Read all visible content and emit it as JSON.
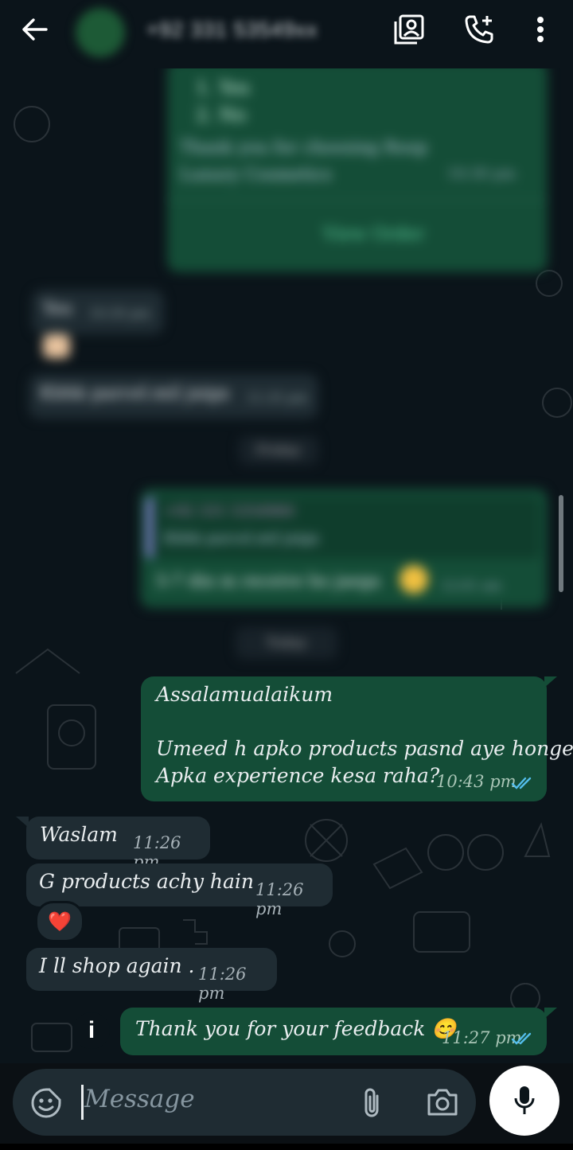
{
  "header": {
    "contact_name": "+92 331 53549xx",
    "back_icon": "arrow-left-icon",
    "contact_card_icon": "contact-card-icon",
    "call_icon": "add-call-icon",
    "menu_icon": "more-vert-icon"
  },
  "blurred_history": {
    "options": [
      "1. Yes",
      "2. No"
    ],
    "thanks": "Thank you for choosing Roop Luxury Cosmetics",
    "thanks_time": "10:30 pm",
    "view_order": "View Order",
    "reply1": "Yes",
    "reply1_time": "10:30 pm",
    "reply2": "Kbhk parcel.mil jaiga",
    "reply2_time": "11:35 pm",
    "day1": "Friday",
    "quote_sender": "+92 331 5354960",
    "quote_text": "Kbhk parcel.mil jaiga",
    "quote_reply": "5-7 din m receive ho jaega",
    "quote_time": "12:01 am",
    "day2": "Today"
  },
  "messages": [
    {
      "dir": "out",
      "lines": [
        "Assalamualaikum",
        "",
        "Umeed h apko products pasnd aye honge.",
        "Apka experience kesa raha?"
      ],
      "time": "10:43 pm"
    },
    {
      "dir": "in",
      "text": "Waslam",
      "time": "11:26 pm"
    },
    {
      "dir": "in",
      "text": "G products achy hain",
      "time": "11:26 pm",
      "reaction": "❤️"
    },
    {
      "dir": "in",
      "text": "I ll shop again .",
      "time": "11:26 pm"
    },
    {
      "dir": "out",
      "text": "Thank you for your feedback 😊",
      "time": "11:27 pm"
    }
  ],
  "composer": {
    "placeholder": "Message",
    "emoji_icon": "sticker-icon",
    "attach_icon": "paperclip-icon",
    "camera_icon": "camera-icon",
    "mic_icon": "microphone-icon"
  },
  "info_glyph": "i",
  "colors": {
    "outgoing": "#144d37",
    "incoming": "#1f2c33",
    "background": "#0b141a",
    "read_tick": "#53bdeb"
  }
}
